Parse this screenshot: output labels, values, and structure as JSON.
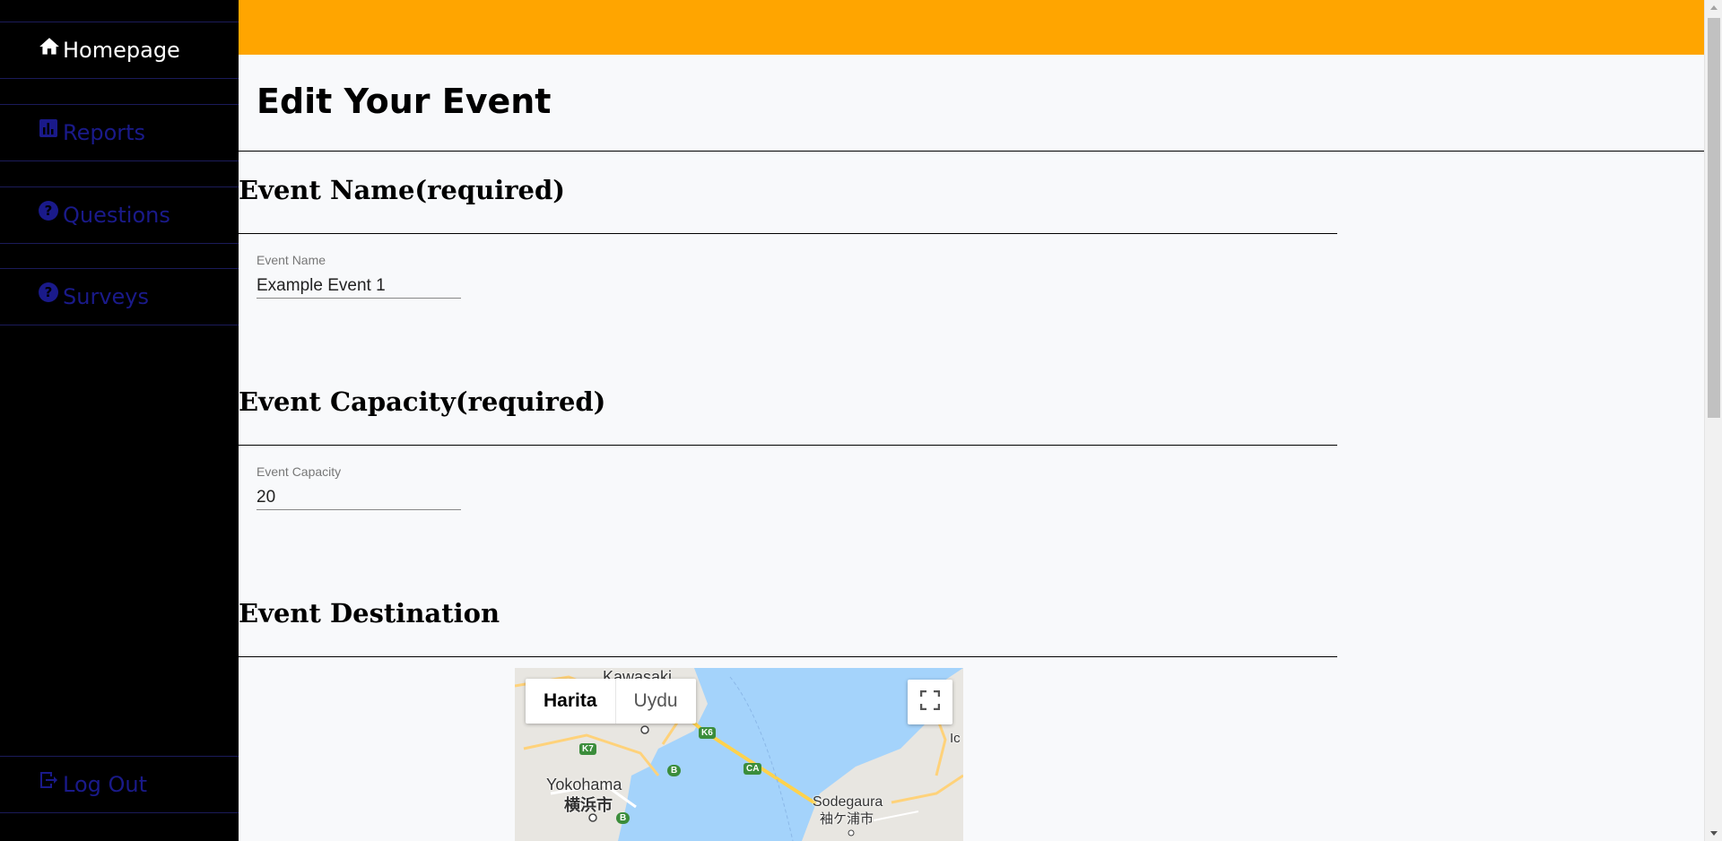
{
  "sidebar": {
    "items": [
      {
        "label": "Homepage",
        "icon": "home-icon"
      },
      {
        "label": "Reports",
        "icon": "chart-icon"
      },
      {
        "label": "Questions",
        "icon": "help-circle-icon"
      },
      {
        "label": "Surveys",
        "icon": "help-circle-icon"
      }
    ],
    "logout": {
      "label": "Log Out",
      "icon": "logout-icon"
    }
  },
  "colors": {
    "topbar": "#ffa500",
    "sidebar": "#000000",
    "active_text": "#ffffff",
    "inactive_text": "#1a1a8a"
  },
  "page": {
    "title": "Edit Your Event"
  },
  "sections": {
    "name": {
      "heading": "Event Name(required)",
      "field_label": "Event Name",
      "value": "Example Event 1"
    },
    "capacity": {
      "heading": "Event Capacity(required)",
      "field_label": "Event Capacity",
      "value": "20"
    },
    "destination": {
      "heading": "Event Destination"
    }
  },
  "map": {
    "tabs": [
      "Harita",
      "Uydu"
    ],
    "labels": {
      "kawasaki": "Kawasaki",
      "yokohama": "Yokohama",
      "yokohama_jp": "横浜市",
      "sodegaura": "Sodegaura",
      "sodegaura_jp": "袖ケ浦市",
      "route_k6": "K6",
      "route_k7": "K7",
      "route_b1": "B",
      "route_b2": "B",
      "route_ca": "CA",
      "edge": "Ic"
    }
  }
}
